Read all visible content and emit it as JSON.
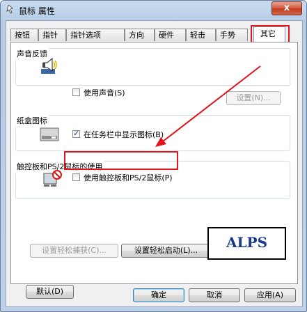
{
  "window": {
    "title": "鼠标 属性",
    "close_label": "x"
  },
  "tabs": [
    {
      "label": "按钮"
    },
    {
      "label": "指针"
    },
    {
      "label": "指针选项"
    },
    {
      "label": "方向"
    },
    {
      "label": "硬件"
    },
    {
      "label": "轻击"
    },
    {
      "label": "手势"
    },
    {
      "label": "其它"
    }
  ],
  "active_tab": "其它",
  "sound": {
    "group_title": "声音反馈",
    "checkbox_label": "使用声音(S)",
    "checked": false,
    "settings_button": "设置(N)..."
  },
  "tray": {
    "group_title": "纸盒图标",
    "checkbox_label": "在任务栏中显示图标(B)",
    "checked": true
  },
  "touchpad": {
    "group_title": "触控板和PS/2鼠标的使用",
    "checkbox_label": "使用触控板和PS/2鼠标(P)",
    "checked": false
  },
  "easy": {
    "capture_button": "设置轻松捕获(C)...",
    "launch_button": "设置轻松启动(L)..."
  },
  "brand": "ALPS",
  "default_button": "默认(D)",
  "footer": {
    "ok": "确定",
    "cancel": "取消",
    "apply": "应用(A)"
  },
  "colors": {
    "highlight": "#e0141c",
    "brand_text": "#183a8c"
  }
}
